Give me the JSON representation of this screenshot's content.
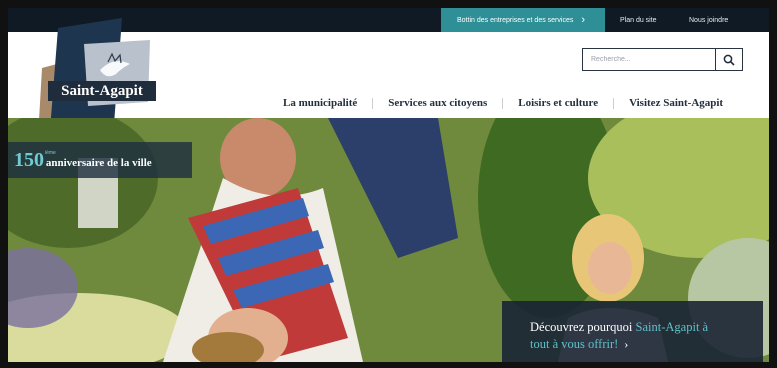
{
  "topbar": {
    "bottin_label": "Bottin des entreprises et des services",
    "plan_label": "Plan du site",
    "joindre_label": "Nous joindre"
  },
  "logo": {
    "name": "Saint-Agapit"
  },
  "search": {
    "placeholder": "Recherche..."
  },
  "nav": {
    "items": [
      {
        "label": "La municipalité"
      },
      {
        "label": "Services aux citoyens"
      },
      {
        "label": "Loisirs et culture"
      },
      {
        "label": "Visitez Saint-Agapit"
      }
    ]
  },
  "hero": {
    "anniv_number": "150",
    "anniv_sup": "ième",
    "anniv_text": "anniversaire de la ville",
    "discover_prefix": "Découvrez pourquoi ",
    "discover_highlight": "Saint-Agapit à",
    "discover_line2_highlight": "tout à vous offrir!"
  },
  "colors": {
    "topbar": "#0f1a24",
    "accent": "#2f8f96",
    "highlight": "#5ec1c8",
    "navy": "#1f2c3b"
  }
}
